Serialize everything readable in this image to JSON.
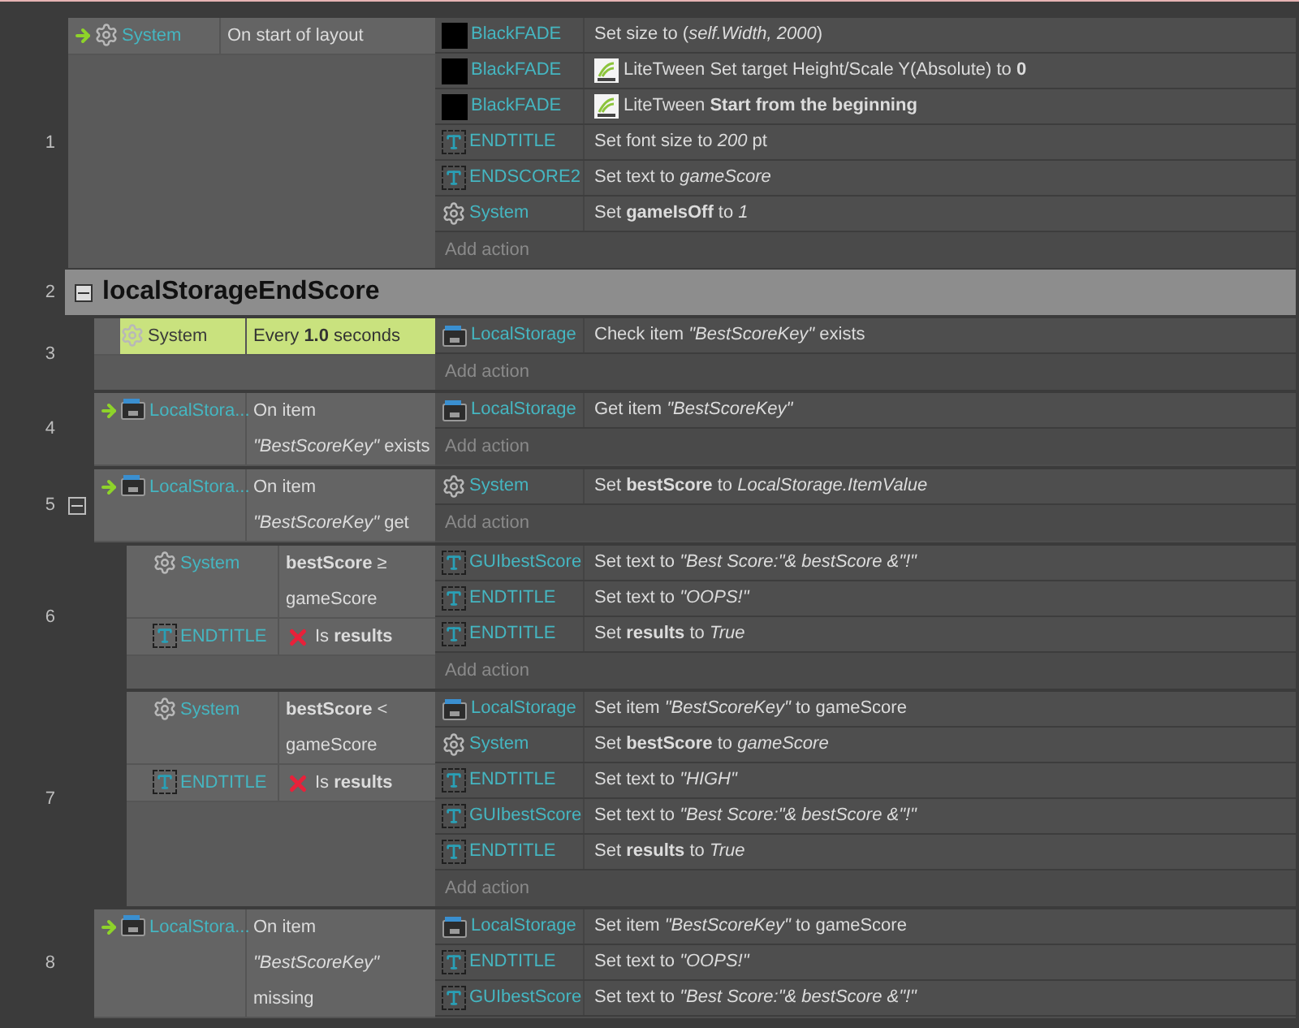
{
  "lines": [
    {
      "kind": "event",
      "number": "1",
      "conditions": [
        {
          "trigger": true,
          "kind": "system",
          "object": "System",
          "text": "On start of layout",
          "inverted": false,
          "selected": false
        }
      ],
      "actions": [
        {
          "kind": "sprite",
          "object": "BlackFADE",
          "tween": false,
          "text": "Set size to (*self.Width, 2000*)"
        },
        {
          "kind": "sprite",
          "object": "BlackFADE",
          "tween": true,
          "text": "LiteTween Set target Height/Scale Y(Absolute) to **0**"
        },
        {
          "kind": "sprite",
          "object": "BlackFADE",
          "tween": true,
          "text": "LiteTween **Start from the beginning**"
        },
        {
          "kind": "text",
          "object": "ENDTITLE",
          "tween": false,
          "text": "Set font size to *200* pt"
        },
        {
          "kind": "text",
          "object": "ENDSCORE2",
          "tween": false,
          "text": "Set text to *gameScore*"
        },
        {
          "kind": "system",
          "object": "System",
          "tween": false,
          "text": "Set **gameIsOff** to *1*"
        }
      ],
      "add_action": "Add action"
    },
    {
      "kind": "group",
      "number": "2",
      "title": "localStorageEndScore",
      "expanded": true,
      "children": [
        {
          "kind": "event",
          "number": "3",
          "conditions": [
            {
              "trigger": false,
              "kind": "system",
              "object": "System",
              "text": "Every **1.0** seconds",
              "inverted": false,
              "selected": true
            }
          ],
          "actions": [
            {
              "kind": "storage",
              "object": "LocalStorage",
              "tween": false,
              "text": "Check item *\"BestScoreKey\"* exists"
            }
          ],
          "add_action": "Add action"
        },
        {
          "kind": "event",
          "number": "4",
          "conditions": [
            {
              "trigger": true,
              "kind": "storage",
              "object": "LocalStora...",
              "text": "On item *\"BestScoreKey\"* exists",
              "inverted": false,
              "selected": false
            }
          ],
          "actions": [
            {
              "kind": "storage",
              "object": "LocalStorage",
              "tween": false,
              "text": "Get item *\"BestScoreKey\"*"
            }
          ],
          "add_action": "Add action"
        },
        {
          "kind": "event",
          "number": "5",
          "expanded": true,
          "conditions": [
            {
              "trigger": true,
              "kind": "storage",
              "object": "LocalStora...",
              "text": "On item *\"BestScoreKey\"* get",
              "inverted": false,
              "selected": false
            }
          ],
          "actions": [
            {
              "kind": "system",
              "object": "System",
              "tween": false,
              "text": "Set **bestScore** to *LocalStorage.ItemValue*"
            }
          ],
          "add_action": "Add action",
          "children": [
            {
              "kind": "event",
              "number": "6",
              "conditions": [
                {
                  "trigger": false,
                  "kind": "system",
                  "object": "System",
                  "text": "**bestScore** ≥ gameScore",
                  "inverted": false,
                  "selected": false
                },
                {
                  "trigger": false,
                  "kind": "text",
                  "object": "ENDTITLE",
                  "text": "Is **results**",
                  "inverted": true,
                  "selected": false
                }
              ],
              "actions": [
                {
                  "kind": "text",
                  "object": "GUIbestScore",
                  "tween": false,
                  "text": "Set text to *\"Best Score:\"& bestScore &\"!\"*"
                },
                {
                  "kind": "text",
                  "object": "ENDTITLE",
                  "tween": false,
                  "text": "Set text to *\"OOPS!\"*"
                },
                {
                  "kind": "text",
                  "object": "ENDTITLE",
                  "tween": false,
                  "text": "Set **results** to *True*"
                }
              ],
              "add_action": "Add action"
            },
            {
              "kind": "event",
              "number": "7",
              "conditions": [
                {
                  "trigger": false,
                  "kind": "system",
                  "object": "System",
                  "text": "**bestScore** < gameScore",
                  "inverted": false,
                  "selected": false
                },
                {
                  "trigger": false,
                  "kind": "text",
                  "object": "ENDTITLE",
                  "text": "Is **results**",
                  "inverted": true,
                  "selected": false
                }
              ],
              "actions": [
                {
                  "kind": "storage",
                  "object": "LocalStorage",
                  "tween": false,
                  "text": "Set item *\"BestScoreKey\"* to gameScore"
                },
                {
                  "kind": "system",
                  "object": "System",
                  "tween": false,
                  "text": "Set **bestScore** to *gameScore*"
                },
                {
                  "kind": "text",
                  "object": "ENDTITLE",
                  "tween": false,
                  "text": "Set text to *\"HIGH\"*"
                },
                {
                  "kind": "text",
                  "object": "GUIbestScore",
                  "tween": false,
                  "text": "Set text to *\"Best Score:\"& bestScore &\"!\"*"
                },
                {
                  "kind": "text",
                  "object": "ENDTITLE",
                  "tween": false,
                  "text": "Set **results** to *True*"
                }
              ],
              "add_action": "Add action"
            }
          ]
        },
        {
          "kind": "event",
          "number": "8",
          "conditions": [
            {
              "trigger": true,
              "kind": "storage",
              "object": "LocalStora...",
              "text": "On item *\"BestScoreKey\"* missing",
              "inverted": false,
              "selected": false
            }
          ],
          "actions": [
            {
              "kind": "storage",
              "object": "LocalStorage",
              "tween": false,
              "text": "Set item *\"BestScoreKey\"* to gameScore"
            },
            {
              "kind": "text",
              "object": "ENDTITLE",
              "tween": false,
              "text": "Set text to *\"OOPS!\"*"
            },
            {
              "kind": "text",
              "object": "GUIbestScore",
              "tween": false,
              "text": "Set text to *\"Best Score:\"& bestScore &\"!\"*"
            }
          ]
        }
      ]
    }
  ]
}
